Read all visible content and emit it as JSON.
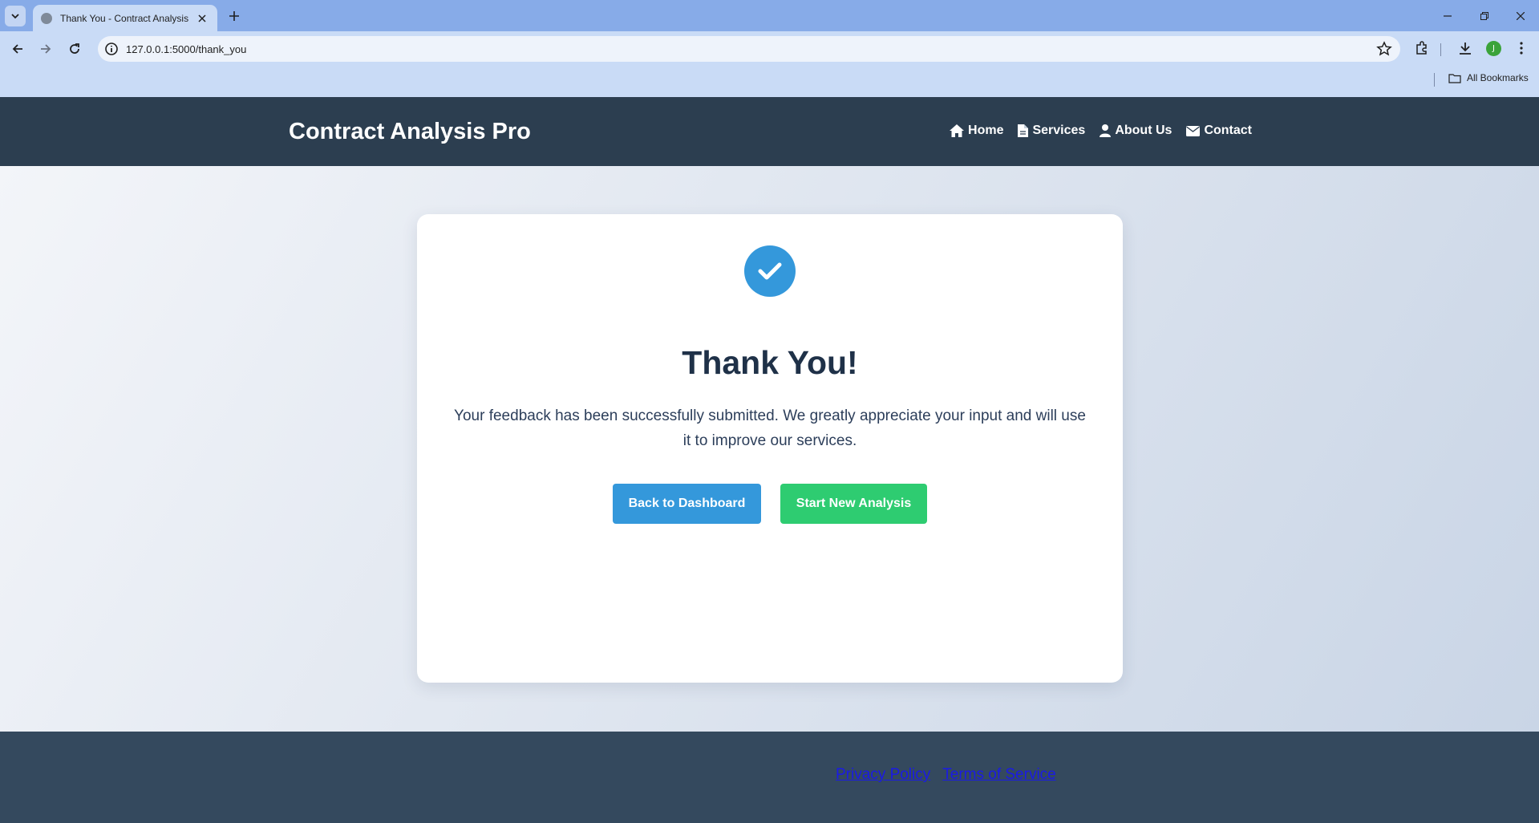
{
  "browser": {
    "tab_title": "Thank You - Contract Analysis Pro",
    "url": "127.0.0.1:5000/thank_you",
    "bookmarks_label": "All Bookmarks",
    "profile_initial": "J"
  },
  "header": {
    "brand": "Contract Analysis Pro",
    "nav": [
      {
        "label": "Home",
        "icon": "home-icon"
      },
      {
        "label": "Services",
        "icon": "file-icon"
      },
      {
        "label": "About Us",
        "icon": "user-icon"
      },
      {
        "label": "Contact",
        "icon": "envelope-icon"
      }
    ]
  },
  "card": {
    "icon": "check-circle-icon",
    "title": "Thank You!",
    "message": "Your feedback has been successfully submitted. We greatly appreciate your input and will use it to improve our services.",
    "primary_button": "Back to Dashboard",
    "secondary_button": "Start New Analysis"
  },
  "footer": {
    "links": [
      "Privacy Policy",
      "Terms of Service"
    ]
  },
  "colors": {
    "header_bg": "#2c3e50",
    "footer_bg": "#34495e",
    "primary": "#3498db",
    "success": "#2ecc71",
    "title": "#1f3148"
  }
}
